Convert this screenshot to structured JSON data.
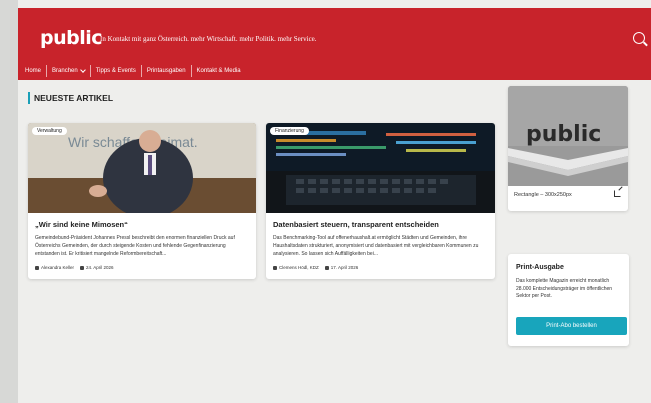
{
  "header": {
    "logo": "public",
    "tagline": "In Kontakt mit ganz Österreich. mehr Wirtschaft. mehr Politik. mehr Service."
  },
  "nav": {
    "items": [
      "Home",
      "Branchen",
      "Tipps & Events",
      "Printausgaben",
      "Kontakt & Media"
    ]
  },
  "section": {
    "title": "NEUESTE ARTIKEL"
  },
  "articles": [
    {
      "badge": "Verwaltung",
      "title": "„Wir sind keine Mimosen“",
      "text": "Gemeindebund-Präsident Johannes Pressl beschreibt den enormen finanziellen Druck auf Österreichs Gemeinden, der durch steigende Kosten und fehlende Gegenfinanzierung entstanden ist. Er kritisiert mangelnde Reformbereitschaft...",
      "author": "Alexandra Keller",
      "date": "24. April 2026",
      "image_text": "Wir schaffen Heimat."
    },
    {
      "badge": "Finanzierung",
      "title": "Datenbasiert steuern, transparent entscheiden",
      "text": "Das Benchmarking-Tool auf offenerhaushalt.at ermöglicht Städten und Gemeinden, ihre Haushaltsdaten strukturiert, anonymisiert und datenbasiert mit vergleichbaren Kommunen zu analysieren. So lassen sich Auffälligkeiten bei...",
      "author": "Clemens Hödl, KDZ",
      "date": "17. April 2026"
    }
  ],
  "ad": {
    "image_text": "public",
    "label": "Rectangle – 300x250px"
  },
  "print": {
    "title": "Print-Ausgabe",
    "text": "Das komplette Magazin erreicht monatlich 28.000 Entscheidungsträger im öffentlichen Sektor per Post.",
    "button": "Print-Abo bestellen"
  },
  "colors": {
    "brand_red": "#c8232b",
    "accent_teal": "#18a5bc"
  }
}
